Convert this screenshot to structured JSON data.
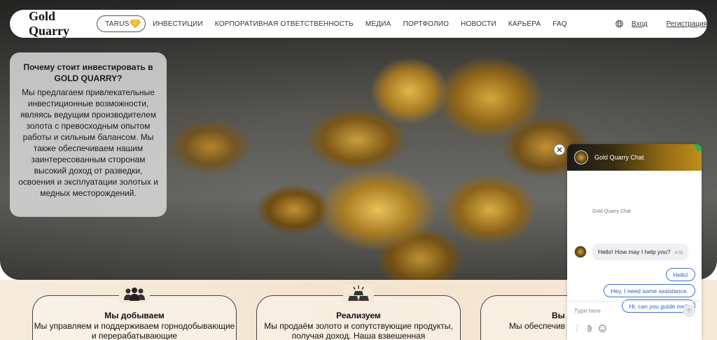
{
  "header": {
    "logo": "Gold Quarry",
    "tarus_label": "TARUS",
    "nav": [
      "ИНВЕСТИЦИИ",
      "КОРПОРАТИВНАЯ ОТВЕТСТВЕННОСТЬ",
      "МЕДИА",
      "ПОРТФОЛИО",
      "НОВОСТИ",
      "КАРЬЕРА",
      "FAQ"
    ],
    "login": "Вход",
    "register": "Регистрация"
  },
  "info_card": {
    "title": "Почему стоит инвестировать в GOLD QUARRY?",
    "text": "Мы предлагаем привлекательные инвестиционные возможности, являясь ведущим производителем золота с превосходным опытом работы и сильным балансом. Мы также обеспечиваем нашим заинтересованным сторонам высокий доход от разведки, освоения и эксплуатации золотых и медных месторождений."
  },
  "features": [
    {
      "icon": "people-group-icon",
      "title": "Мы добываем",
      "text": "Мы управляем и поддерживаем горнодобывающие и перерабатывающие"
    },
    {
      "icon": "gold-bars-icon",
      "title": "Реализуем",
      "text": "Мы продаём золото и сопутствующие продукты, получая доход. Наша взвешенная"
    },
    {
      "icon": "",
      "title": "Вы",
      "text": "Мы обеспечив баланс и растущий с"
    }
  ],
  "chat": {
    "title": "Gold Quarry Chat",
    "bot_name": "Gold Quarry Chat",
    "bot_message": "Hello! How may I help you?",
    "bot_time": "4:03",
    "replies": [
      "Hello!",
      "Hey, I need some assistance.",
      "Hi, can you guide me?"
    ],
    "input_placeholder": "Type here"
  },
  "colors": {
    "accent_gold": "#c08d1c",
    "reply_blue": "#2f5fb3",
    "online_green": "#2bb34a"
  }
}
